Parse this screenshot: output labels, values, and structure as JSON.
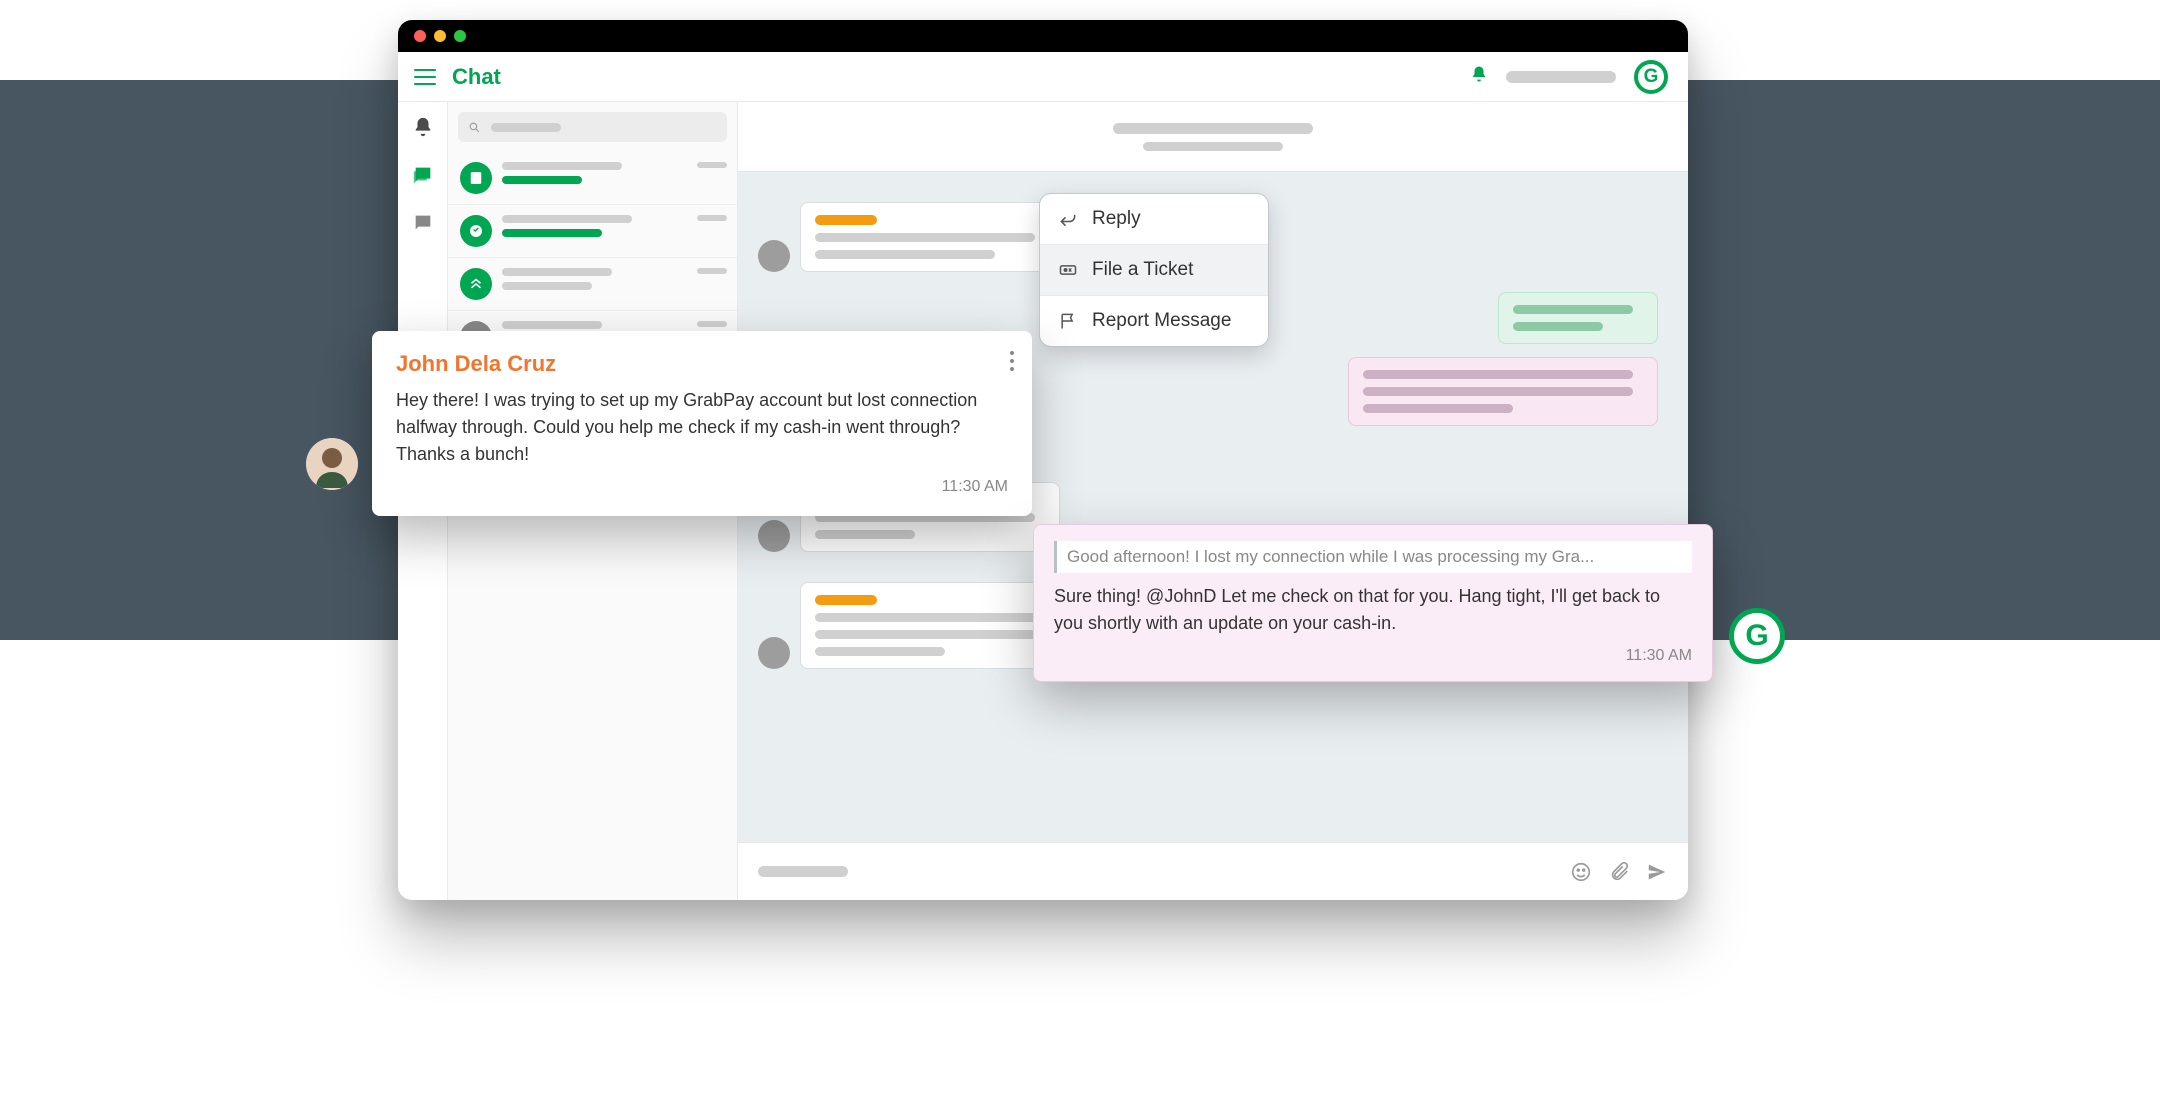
{
  "header": {
    "title": "Chat"
  },
  "context_menu": {
    "reply": "Reply",
    "file_ticket": "File a Ticket",
    "report": "Report Message"
  },
  "customer_message": {
    "name": "John Dela Cruz",
    "text": "Hey there! I was trying to set up my GrabPay account but lost connection halfway through. Could you help me check if my cash-in went through? Thanks a bunch!",
    "time": "11:30 AM"
  },
  "agent_reply": {
    "quote": "Good afternoon! I lost my connection while I was processing my Gra...",
    "text": "Sure thing! @JohnD Let me check on that for you. Hang tight, I'll get back to you shortly with an update on your cash-in.",
    "time": "11:30 AM"
  }
}
